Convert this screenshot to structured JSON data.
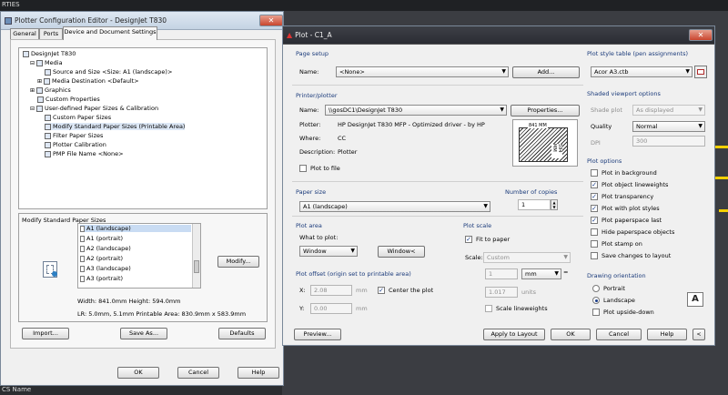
{
  "background": {
    "top_text": "RTIES",
    "bottom_text": "CS Name",
    "yellow": "#f5d000"
  },
  "pce": {
    "title": "Plotter Configuration Editor - DesignJet T830",
    "tabs": [
      "General",
      "Ports",
      "Device and Document Settings"
    ],
    "tree": [
      "DesignJet T830",
      "Media",
      "Source and Size <Size: A1 (landscape)>",
      "Media Destination <Default>",
      "Graphics",
      "Custom Properties",
      "User-defined Paper Sizes & Calibration",
      "Custom Paper Sizes",
      "Modify Standard Paper Sizes (Printable Area)",
      "Filter Paper Sizes",
      "Plotter Calibration",
      "PMP File Name <None>"
    ],
    "modify_group": "Modify Standard Paper Sizes",
    "paper_list": [
      "A1 (landscape)",
      "A1 (portrait)",
      "A2 (landscape)",
      "A2 (portrait)",
      "A3 (landscape)",
      "A3 (portrait)"
    ],
    "modify_btn": "Modify...",
    "dims": "Width: 841.0mm  Height: 594.0mm",
    "lr": "LR: 5.0mm, 5.1mm  Printable Area: 830.9mm x 583.9mm",
    "import_btn": "Import...",
    "saveas_btn": "Save As...",
    "defaults_btn": "Defaults",
    "ok": "OK",
    "cancel": "Cancel",
    "help": "Help"
  },
  "plot": {
    "title": "Plot - C1_A",
    "page_setup": {
      "group": "Page setup",
      "name_label": "Name:",
      "name_value": "<None>",
      "add_btn": "Add..."
    },
    "printer": {
      "group": "Printer/plotter",
      "name_label": "Name:",
      "name_value": "\\\\gosDC1\\DesignJet T830",
      "props_btn": "Properties...",
      "plotter_label": "Plotter:",
      "plotter_value": "HP DesignJet T830 MFP - Optimized driver - by HP",
      "where_label": "Where:",
      "where_value": "CC",
      "desc_label": "Description:",
      "desc_value": "Plotter",
      "plot_to_file": "Plot to file",
      "preview_w": "841 MM",
      "preview_h": "594 MM"
    },
    "paper_size": {
      "group": "Paper size",
      "value": "A1 (landscape)"
    },
    "copies": {
      "group": "Number of copies",
      "value": "1"
    },
    "plot_area": {
      "group": "Plot area",
      "what_label": "What to plot:",
      "what_value": "Window",
      "window_btn": "Window<"
    },
    "plot_scale": {
      "group": "Plot scale",
      "fit": "Fit to paper",
      "scale_label": "Scale:",
      "scale_value": "Custom",
      "num": "1",
      "unit": "mm",
      "den": "1.017",
      "den_unit": "units",
      "scale_lw": "Scale lineweights"
    },
    "offset": {
      "group": "Plot offset (origin set to printable area)",
      "x_label": "X:",
      "x_value": "2.08",
      "y_label": "Y:",
      "y_value": "0.00",
      "unit": "mm",
      "center": "Center the plot"
    },
    "style_table": {
      "group": "Plot style table (pen assignments)",
      "value": "Acor A3.ctb"
    },
    "shaded": {
      "group": "Shaded viewport options",
      "shade_label": "Shade plot",
      "shade_value": "As displayed",
      "quality_label": "Quality",
      "quality_value": "Normal",
      "dpi_label": "DPI",
      "dpi_value": "300"
    },
    "options": {
      "group": "Plot options",
      "items": [
        {
          "label": "Plot in background",
          "checked": false
        },
        {
          "label": "Plot object lineweights",
          "checked": true
        },
        {
          "label": "Plot transparency",
          "checked": true
        },
        {
          "label": "Plot with plot styles",
          "checked": true
        },
        {
          "label": "Plot paperspace last",
          "checked": true
        },
        {
          "label": "Hide paperspace objects",
          "checked": false
        },
        {
          "label": "Plot stamp on",
          "checked": false
        },
        {
          "label": "Save changes to layout",
          "checked": false
        }
      ]
    },
    "orientation": {
      "group": "Drawing orientation",
      "portrait": "Portrait",
      "landscape": "Landscape",
      "upside": "Plot upside-down",
      "icon_letter": "A"
    },
    "preview_btn": "Preview...",
    "apply_btn": "Apply to Layout",
    "ok": "OK",
    "cancel": "Cancel",
    "help": "Help"
  }
}
